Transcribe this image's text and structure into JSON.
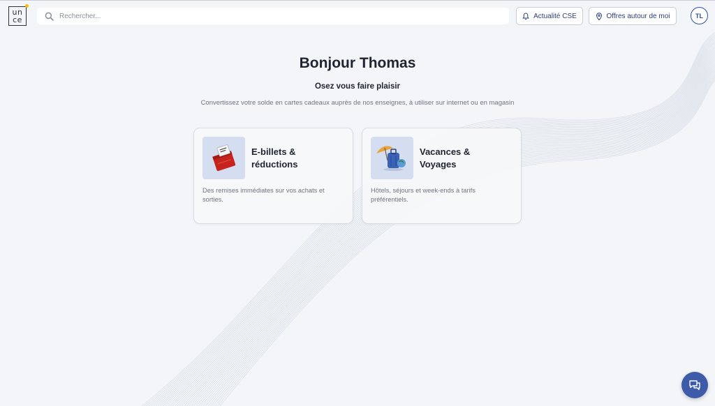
{
  "header": {
    "logo_line1": "un",
    "logo_line2": "ce",
    "search_placeholder": "Rechercher...",
    "news_label": "Actualité CSE",
    "offers_label": "Offres autour de moi",
    "avatar_initials": "TL"
  },
  "hero": {
    "title": "Bonjour Thomas",
    "subtitle": "Osez vous faire plaisir",
    "description": "Convertissez votre solde en cartes cadeaux auprès de nos enseignes, à utiliser sur internet ou en magasin"
  },
  "cards": [
    {
      "title_line1": "E-billets &",
      "title_line2": "réductions",
      "description": "Des remises immédiates sur vos achats et sorties.",
      "icon": "ticket-icon"
    },
    {
      "title_line1": "Vacances &",
      "title_line2": "Voyages",
      "description": "Hôtels, séjours et week-ends à tarifs préférentiels.",
      "icon": "suitcase-icon"
    }
  ],
  "colors": {
    "accent": "#2e4fa0",
    "background": "#f3f5f8",
    "chat_button": "#3d5ba8",
    "logo_dot": "#f2c200"
  }
}
